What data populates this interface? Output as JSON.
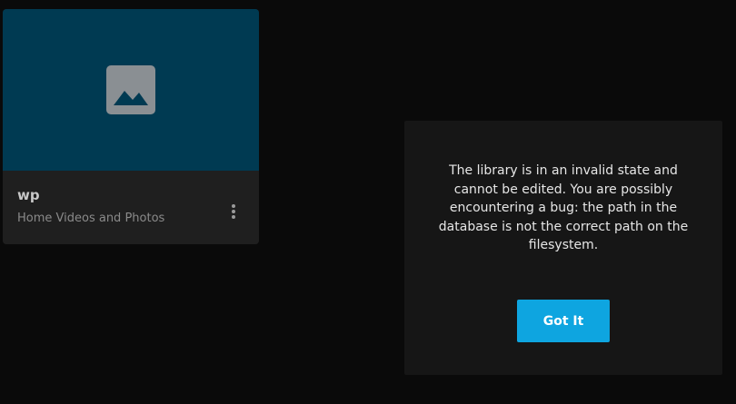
{
  "library_card": {
    "title": "wp",
    "subtitle": "Home Videos and Photos",
    "thumbnail_icon": "image-placeholder-icon",
    "menu_icon": "more-vertical-icon",
    "thumbnail_color": "#003a52"
  },
  "dialog": {
    "message": "The library is in an invalid state and cannot be edited. You are possibly encountering a bug: the path in the database is not the correct path on the filesystem.",
    "confirm_label": "Got It",
    "accent_color": "#0ea5e0"
  }
}
